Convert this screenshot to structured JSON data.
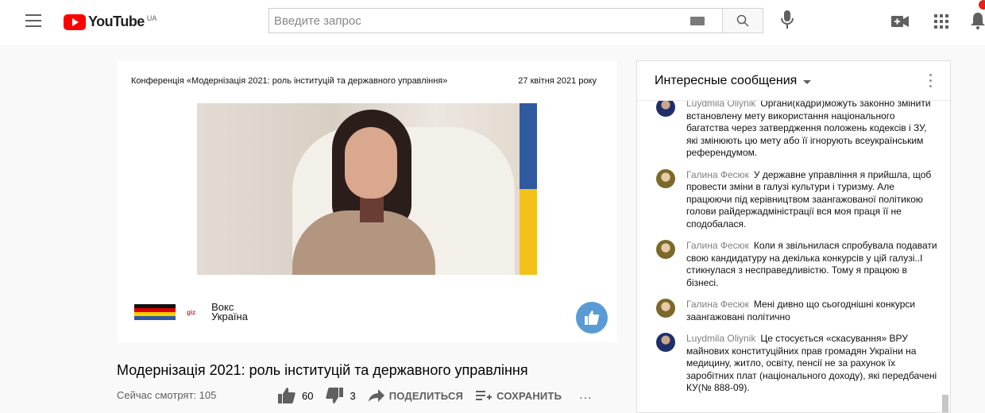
{
  "header": {
    "logo_text": "YouTube",
    "country_code": "UA",
    "search_placeholder": "Введите запрос"
  },
  "video": {
    "conference_title": "Конференція «Модернізація 2021: роль інституцій та державного управління»",
    "conference_date": "27 квітня 2021 року",
    "partner_text": "Вокс Україна",
    "partner_line1": "Вокс",
    "partner_line2": "Україна",
    "giz_text": "giz"
  },
  "meta": {
    "title": "Модернізація 2021: роль інституцій та державного управління",
    "viewers": "Сейчас смотрят: 105",
    "likes": "60",
    "dislikes": "3",
    "share_label": "ПОДЕЛИТЬСЯ",
    "save_label": "СОХРАНИТЬ",
    "more": "..."
  },
  "chat": {
    "title": "Интересные сообщения",
    "messages": [
      {
        "author": "Luydmila Oliynik",
        "text": "Органи(кадри)можуть законно змінити встановлену мету використання національного багатства через затвердження положень кодексів і ЗУ, які змінюють цю мету або її ігнорують всеукраїнським референдумом."
      },
      {
        "author": "Галина Фесюк",
        "text": "У державне управління я прийшла, щоб провести зміни в галузі культури і туризму. Але працюючи під керівництвом заангажованої політикою голови райдержадміністрації вся моя праця її не сподобалася."
      },
      {
        "author": "Галина Фесюк",
        "text": "Коли я звільнилася спробувала подавати свою кандидатуру на декілька конкурсів у цій галузі..І стикнулася з несправедливістю. Тому я працюю в бізнесі."
      },
      {
        "author": "Галина Фесюк",
        "text": "Мені дивно що сьогоднішні конкурси заангажовані політично"
      },
      {
        "author": "Luydmila Oliynik",
        "text": "Це стосується «скасування» ВРУ майнових конституційних прав громадян України на медицину, житло, освіту, пенсії не за рахунок їх заробітних плат (національного доходу), які передбачені КУ(№ 888-09)."
      }
    ]
  }
}
